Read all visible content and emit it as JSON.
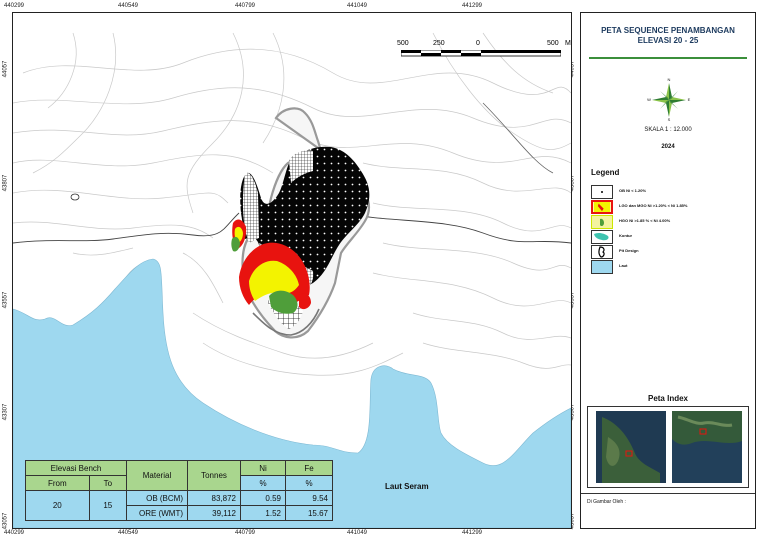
{
  "coords": {
    "x": [
      "440299",
      "440549",
      "440799",
      "441049",
      "441299"
    ],
    "y": [
      "44057",
      "43807",
      "43557",
      "43307",
      "43057"
    ]
  },
  "scalebar": {
    "labels": [
      "500",
      "250",
      "0",
      "500"
    ],
    "unit": "M"
  },
  "sea_label": "Laut Seram",
  "bench_table": {
    "header_group": "Elevasi Bench",
    "from": "From",
    "to": "To",
    "material": "Material",
    "tonnes": "Tonnes",
    "ni": "Ni",
    "fe": "Fe",
    "pct": "%",
    "from_val": "20",
    "to_val": "15",
    "rows": [
      {
        "material": "OB (BCM)",
        "tonnes": "83,872",
        "ni": "0.59",
        "fe": "9.54"
      },
      {
        "material": "ORE (WMT)",
        "tonnes": "39,112",
        "ni": "1.52",
        "fe": "15.67"
      }
    ]
  },
  "panel": {
    "title_line1": "PETA SEQUENCE PENAMBANGAN",
    "title_line2": "ELEVASI  20 - 25",
    "compass_letters": {
      "n": "N",
      "s": "S",
      "e": "E",
      "w": "W"
    },
    "scale": "SKALA  1 : 12.000",
    "year": "2024",
    "legend_title": "Legend",
    "legend": [
      {
        "label": "OB Ni < 1.20%",
        "icon": "black-dot-pattern"
      },
      {
        "label": "LGO dan MGO Ni >1.20% < Ni 1.85%",
        "icon": "red-yellow-shape"
      },
      {
        "label": "HGO Ni >1.85 % < Ni 4.00%",
        "icon": "green-shape"
      },
      {
        "label": "Kontur",
        "icon": "contour-shape"
      },
      {
        "label": "Pit Design",
        "icon": "pit-outline"
      },
      {
        "label": "Laut",
        "icon": "sea-swatch"
      }
    ],
    "index_title": "Peta Index",
    "drawn_by": "Di Gambar Oleh :"
  },
  "colors": {
    "sea": "#9ed8ef",
    "ore_red": "#e8130f",
    "ore_yellow": "#f3f300",
    "ore_green": "#4f9e3a",
    "table_header": "#a9d68e",
    "title": "#1c3a5e"
  }
}
